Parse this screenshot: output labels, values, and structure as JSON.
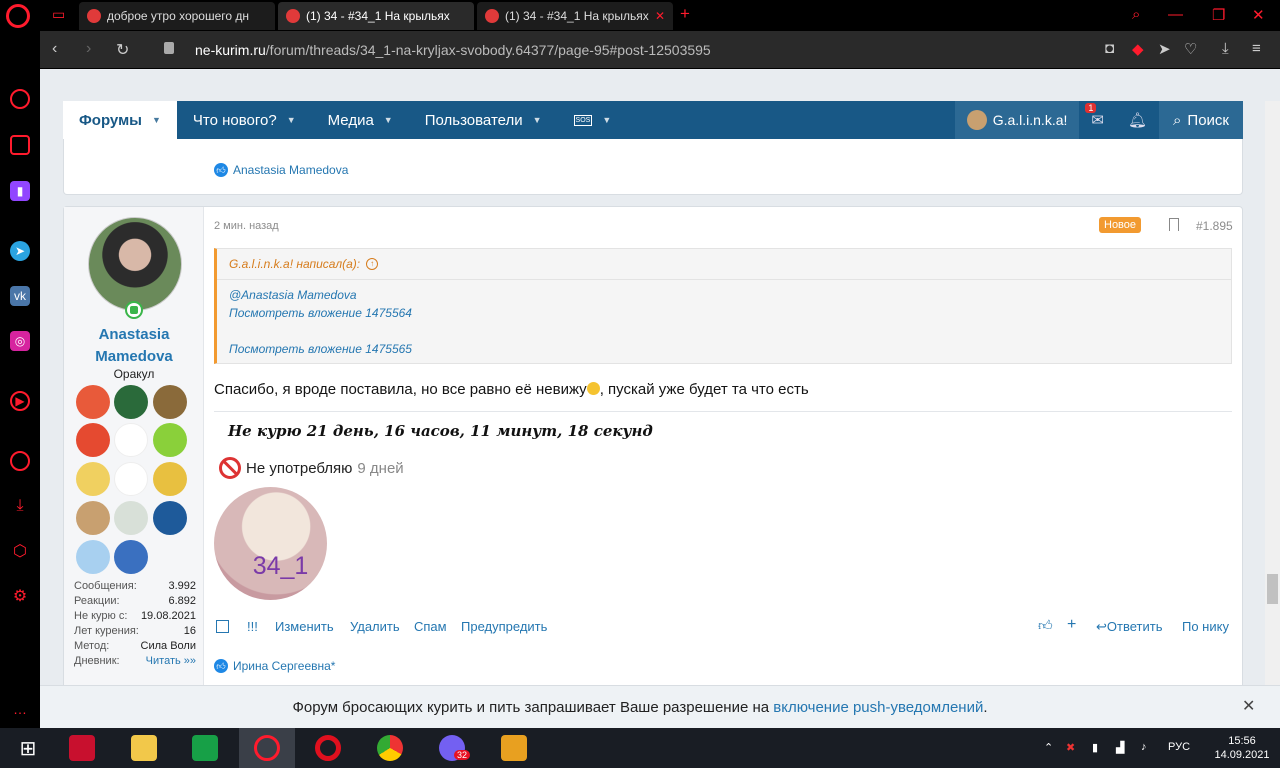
{
  "browser": {
    "tabs": [
      {
        "title": "доброе утро хорошего дн",
        "favicon_color": "#e03a3a"
      },
      {
        "title": "(1) 34 - #34_1 На крыльях",
        "favicon_color": "#e03a3a"
      },
      {
        "title": "(1) 34 - #34_1 На крыльях",
        "favicon_color": "#e03a3a"
      }
    ],
    "new_tab_label": "+",
    "url_host": "ne-kurim.ru",
    "url_path": "/forum/threads/34_1-na-kryljax-svobody.64377/page-95#post-12503595",
    "accent": "#ff1b2d"
  },
  "forum_nav": {
    "items": [
      "Форумы",
      "Что нового?",
      "Медиа",
      "Пользователи"
    ],
    "sos_label": "SOS",
    "user_name": "G.a.l.i.n.k.a!",
    "inbox_badge": "1",
    "search_label": "Поиск"
  },
  "prev_post": {
    "reacted_by": "Anastasia Mamedova"
  },
  "post": {
    "author": "Anastasia Mamedova",
    "user_title": "Оракул",
    "time": "2 мин. назад",
    "new_label": "Новое",
    "post_number": "#1.895",
    "quote": {
      "header": "G.a.l.i.n.k.a! написал(а):",
      "lines": [
        "@Anastasia Mamedova",
        "Посмотреть вложение 1475564",
        "Посмотреть вложение 1475565"
      ]
    },
    "message_before": "Спасибо, я вроде поставила, но все равно её невижу",
    "message_after": ", пускай уже будет та что есть",
    "signature": {
      "counter": "Не курю  21 день, 16 часов, 11 минут, 18 секунд",
      "use_label": "Не употребляю",
      "use_days": "9 дней",
      "image_text": "34_1"
    },
    "stats": [
      {
        "label": "Сообщения:",
        "value": "3.992"
      },
      {
        "label": "Реакции:",
        "value": "6.892"
      },
      {
        "label": "Не курю с:",
        "value": "19.08.2021"
      },
      {
        "label": "Лет курения:",
        "value": "16"
      },
      {
        "label": "Метод:",
        "value": "Сила Воли"
      },
      {
        "label": "Дневник:",
        "value": "Читать »»"
      }
    ],
    "actions": {
      "excl": "!!!",
      "edit": "Изменить",
      "delete": "Удалить",
      "spam": "Спам",
      "warn": "Предупредить",
      "reply": "Ответить",
      "by_nick": "По нику"
    },
    "reacted_by": "Ирина Сергеевна*"
  },
  "push": {
    "text": "Форум бросающих курить и пить запрашивает Ваше разрешение на",
    "link": "включение push-уведомлений",
    "end": "."
  },
  "taskbar": {
    "lang": "РУС",
    "time": "15:56",
    "date": "14.09.2021",
    "viber_badge": "32"
  }
}
